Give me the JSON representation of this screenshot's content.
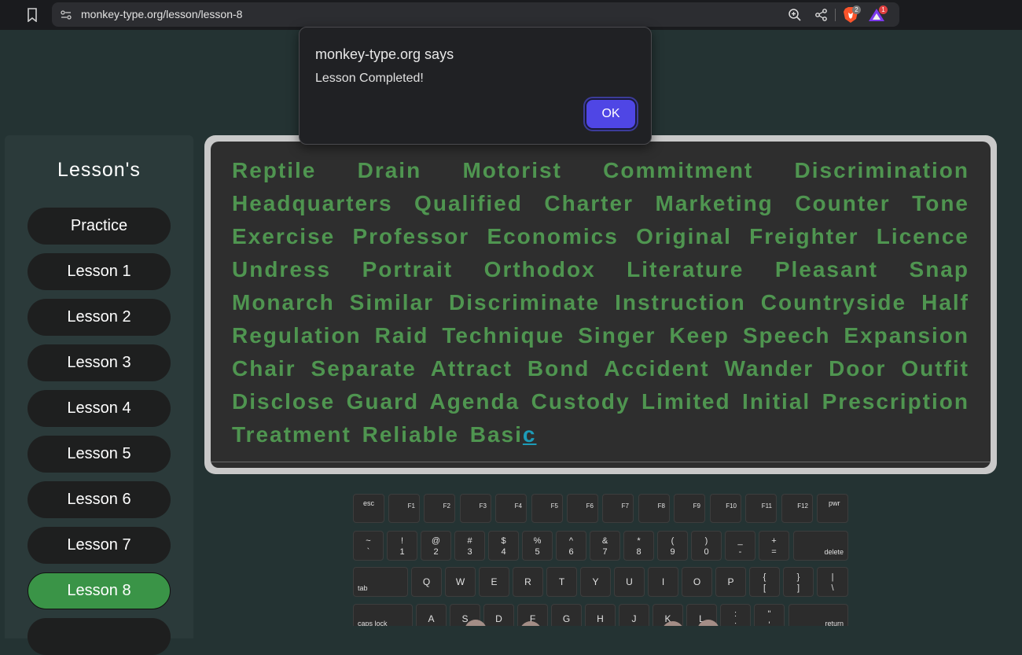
{
  "browser": {
    "url": "monkey-type.org/lesson/lesson-8",
    "brave_badge": "2",
    "rewards_badge": "1"
  },
  "alert": {
    "title": "monkey-type.org says",
    "message": "Lesson Completed!",
    "ok_label": "OK"
  },
  "sidebar": {
    "title": "Lesson's",
    "items": [
      {
        "label": "Practice",
        "active": false
      },
      {
        "label": "Lesson 1",
        "active": false
      },
      {
        "label": "Lesson 2",
        "active": false
      },
      {
        "label": "Lesson 3",
        "active": false
      },
      {
        "label": "Lesson 4",
        "active": false
      },
      {
        "label": "Lesson 5",
        "active": false
      },
      {
        "label": "Lesson 6",
        "active": false
      },
      {
        "label": "Lesson 7",
        "active": false
      },
      {
        "label": "Lesson 8",
        "active": true
      },
      {
        "label": "",
        "active": false
      }
    ]
  },
  "typing": {
    "typed_text": "Reptile Drain Motorist Commitment Discrimination Headquarters Qualified Charter Marketing Counter Tone Exercise Professor Economics Original Freighter Licence Undress Portrait Orthodox Literature Pleasant Snap Monarch Similar Discriminate Instruction Countryside Half Regulation Raid Technique Singer Keep Speech Expansion Chair Separate Attract Bond Accident Wander Door Outfit Disclose Guard Agenda Custody Limited Initial Prescription Treatment Reliable Basi",
    "current_char": "c"
  },
  "colors": {
    "background": "#243333",
    "typed_text": "#4f9550",
    "current_char": "#1d9bb8",
    "active_lesson": "#3a9447",
    "ok_button": "#4f46e5"
  },
  "keyboard": {
    "row_function": [
      "esc",
      "F1",
      "F2",
      "F3",
      "F4",
      "F5",
      "F6",
      "F7",
      "F8",
      "F9",
      "F10",
      "F11",
      "F12",
      "pwr"
    ],
    "row_number": [
      {
        "top": "~",
        "bottom": "`"
      },
      {
        "top": "!",
        "bottom": "1"
      },
      {
        "top": "@",
        "bottom": "2"
      },
      {
        "top": "#",
        "bottom": "3"
      },
      {
        "top": "$",
        "bottom": "4"
      },
      {
        "top": "%",
        "bottom": "5"
      },
      {
        "top": "^",
        "bottom": "6"
      },
      {
        "top": "&",
        "bottom": "7"
      },
      {
        "top": "*",
        "bottom": "8"
      },
      {
        "top": "(",
        "bottom": "9"
      },
      {
        "top": ")",
        "bottom": "0"
      },
      {
        "top": "_",
        "bottom": "-"
      },
      {
        "top": "+",
        "bottom": "="
      }
    ],
    "delete_label": "delete",
    "tab_label": "tab",
    "row_top": [
      "Q",
      "W",
      "E",
      "R",
      "T",
      "Y",
      "U",
      "I",
      "O",
      "P"
    ],
    "row_top_symbols": [
      {
        "top": "{",
        "bottom": "["
      },
      {
        "top": "}",
        "bottom": "]"
      },
      {
        "top": "|",
        "bottom": "\\"
      }
    ],
    "caps_label": "caps lock",
    "row_home": [
      "A",
      "S",
      "D",
      "F",
      "G",
      "H",
      "J",
      "K",
      "L"
    ],
    "row_home_symbols": [
      {
        "top": ":",
        "bottom": ";"
      },
      {
        "top": "\"",
        "bottom": "'"
      }
    ],
    "return_label": "return"
  }
}
